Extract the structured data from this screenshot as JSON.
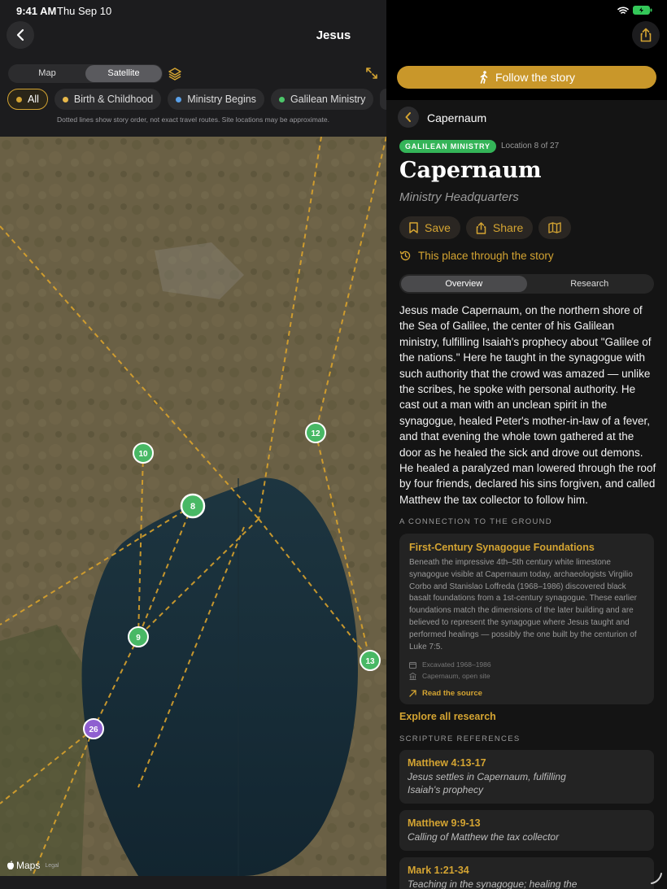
{
  "status": {
    "time": "9:41 AM",
    "date": "Thu Sep 10"
  },
  "header": {
    "title": "Jesus"
  },
  "map_view": {
    "options": [
      "Map",
      "Satellite"
    ],
    "selected": "Satellite"
  },
  "filters": [
    {
      "label": "All",
      "color": "#d4a432",
      "active": true
    },
    {
      "label": "Birth & Childhood",
      "color": "#e8b84a",
      "active": false
    },
    {
      "label": "Ministry Begins",
      "color": "#5aa0e8",
      "active": false
    },
    {
      "label": "Galilean Ministry",
      "color": "#4cc76a",
      "active": false
    }
  ],
  "map_note": "Dotted lines show story order, not exact travel routes. Site locations may be approximate.",
  "markers": [
    {
      "label": "10",
      "color": "#48b865"
    },
    {
      "label": "8",
      "color": "#48b865"
    },
    {
      "label": "12",
      "color": "#48b865"
    },
    {
      "label": "9",
      "color": "#48b865"
    },
    {
      "label": "13",
      "color": "#48b865"
    },
    {
      "label": "26",
      "color": "#8f5fd0"
    }
  ],
  "maps_logo": {
    "brand": "Maps",
    "legal": "Legal"
  },
  "detail": {
    "follow_label": "Follow the story",
    "location_name": "Capernaum",
    "badge": "GALILEAN MINISTRY",
    "location_count": "Location 8 of 27",
    "title": "Capernaum",
    "subtitle": "Ministry Headquarters",
    "save_label": "Save",
    "share_label": "Share",
    "through_story": "This place through the story",
    "tabs": [
      "Overview",
      "Research"
    ],
    "overview": "Jesus made Capernaum, on the northern shore of the Sea of Galilee, the center of his Galilean ministry, fulfilling Isaiah's prophecy about \"Galilee of the nations.\" Here he taught in the synagogue with such authority that the crowd was amazed — unlike the scribes, he spoke with personal authority. He cast out a man with an unclean spirit in the synagogue, healed Peter's mother-in-law of a fever, and that evening the whole town gathered at the door as he healed the sick and drove out demons. He healed a paralyzed man lowered through the roof by four friends, declared his sins forgiven, and called Matthew the tax collector to follow him.",
    "connection_label": "A CONNECTION TO THE GROUND",
    "research_card": {
      "title": "First-Century Synagogue Foundations",
      "body": "Beneath the impressive 4th–5th century white limestone synagogue visible at Capernaum today, archaeologists Virgilio Corbo and Stanislao Loffreda (1968–1986) discovered black basalt foundations from a 1st-century synagogue. These earlier foundations match the dimensions of the later building and are believed to represent the synagogue where Jesus taught and performed healings — possibly the one built by the centurion of Luke 7:5.",
      "excavated": "Excavated 1968–1986",
      "site": "Capernaum, open site",
      "source_label": "Read the source"
    },
    "explore_label": "Explore all research",
    "scripture_label": "SCRIPTURE REFERENCES",
    "references": [
      {
        "ref": "Matthew 4:13-17",
        "desc": "Jesus settles in Capernaum, fulfilling Isaiah's prophecy"
      },
      {
        "ref": "Matthew 9:9-13",
        "desc": "Calling of Matthew the tax collector"
      },
      {
        "ref": "Mark 1:21-34",
        "desc": "Teaching in the synagogue; healing the"
      }
    ]
  }
}
